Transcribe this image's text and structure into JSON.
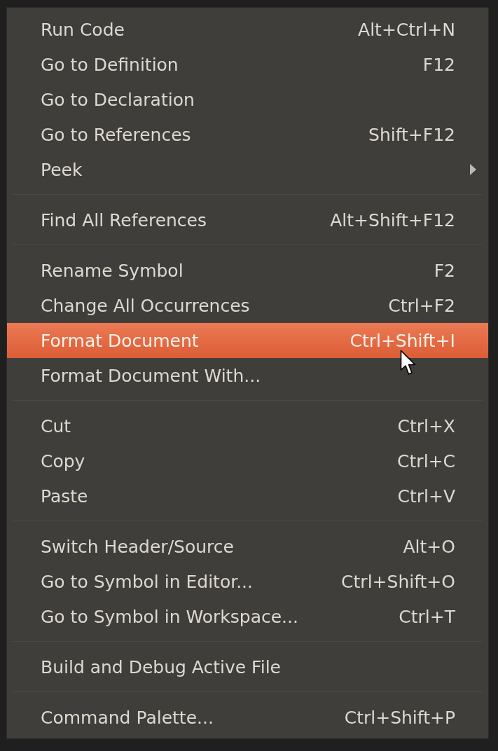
{
  "menu": {
    "groups": [
      {
        "items": [
          {
            "label": "Run Code",
            "shortcut": "Alt+Ctrl+N",
            "submenu": false,
            "selected": false
          },
          {
            "label": "Go to Definition",
            "shortcut": "F12",
            "submenu": false,
            "selected": false
          },
          {
            "label": "Go to Declaration",
            "submenu": false,
            "selected": false
          },
          {
            "label": "Go to References",
            "shortcut": "Shift+F12",
            "submenu": false,
            "selected": false
          },
          {
            "label": "Peek",
            "submenu": true,
            "selected": false
          }
        ]
      },
      {
        "items": [
          {
            "label": "Find All References",
            "shortcut": "Alt+Shift+F12",
            "submenu": false,
            "selected": false
          }
        ]
      },
      {
        "items": [
          {
            "label": "Rename Symbol",
            "shortcut": "F2",
            "submenu": false,
            "selected": false
          },
          {
            "label": "Change All Occurrences",
            "shortcut": "Ctrl+F2",
            "submenu": false,
            "selected": false
          },
          {
            "label": "Format Document",
            "shortcut": "Ctrl+Shift+I",
            "submenu": false,
            "selected": true
          },
          {
            "label": "Format Document With...",
            "submenu": false,
            "selected": false
          }
        ]
      },
      {
        "items": [
          {
            "label": "Cut",
            "shortcut": "Ctrl+X",
            "submenu": false,
            "selected": false
          },
          {
            "label": "Copy",
            "shortcut": "Ctrl+C",
            "submenu": false,
            "selected": false
          },
          {
            "label": "Paste",
            "shortcut": "Ctrl+V",
            "submenu": false,
            "selected": false
          }
        ]
      },
      {
        "items": [
          {
            "label": "Switch Header/Source",
            "shortcut": "Alt+O",
            "submenu": false,
            "selected": false
          },
          {
            "label": "Go to Symbol in Editor...",
            "shortcut": "Ctrl+Shift+O",
            "submenu": false,
            "selected": false
          },
          {
            "label": "Go to Symbol in Workspace...",
            "shortcut": "Ctrl+T",
            "submenu": false,
            "selected": false
          }
        ]
      },
      {
        "items": [
          {
            "label": "Build and Debug Active File",
            "submenu": false,
            "selected": false
          }
        ]
      },
      {
        "items": [
          {
            "label": "Command Palette...",
            "shortcut": "Ctrl+Shift+P",
            "submenu": false,
            "selected": false
          }
        ]
      }
    ]
  }
}
